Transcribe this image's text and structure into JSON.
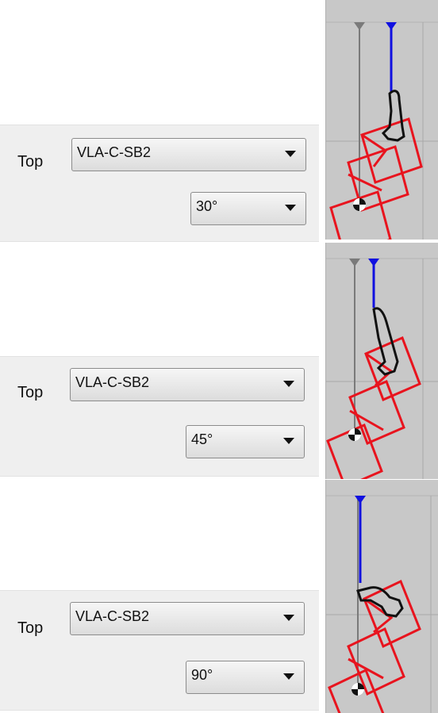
{
  "rows": [
    {
      "label": "Top",
      "profile": "VLA-C-SB2",
      "angle": "30°"
    },
    {
      "label": "Top",
      "profile": "VLA-C-SB2",
      "angle": "45°"
    },
    {
      "label": "Top",
      "profile": "VLA-C-SB2",
      "angle": "90°"
    }
  ],
  "icons": {
    "dropdown_arrow": "chevron-down-icon",
    "marker": "center-of-mass-icon"
  },
  "colors": {
    "panel_bg": "#efefef",
    "view_bg": "#c8c8c8",
    "blue_line": "#1010e0",
    "gray_line": "#7a7a7a",
    "red_outline": "#e8141e",
    "black_shape": "#111111"
  }
}
